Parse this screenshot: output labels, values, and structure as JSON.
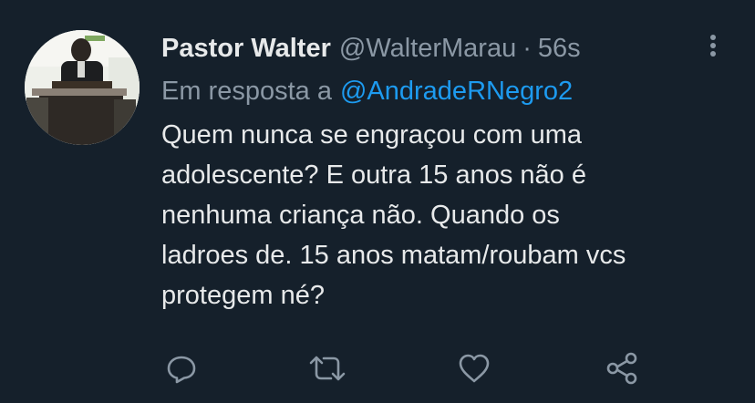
{
  "tweet": {
    "display_name": "Pastor Walter",
    "handle": "@WalterMarau",
    "separator": "·",
    "time": "56s",
    "reply_prefix": "Em resposta a",
    "reply_to": "@AndradeRNegro2",
    "text": "Quem nunca se engraçou com uma\nadolescente? E outra 15 anos não é\nnenhuma criança não. Quando os\nladroes de. 15 anos matam/roubam vcs\nprotegem né?"
  },
  "icons": {
    "more": "more-vertical-icon",
    "reply": "reply-icon",
    "retweet": "retweet-icon",
    "like": "heart-icon",
    "share": "share-icon"
  },
  "colors": {
    "background": "#15202b",
    "primary_text": "#e7e9ea",
    "secondary_text": "#8b98a5",
    "accent": "#1d9bf0"
  }
}
